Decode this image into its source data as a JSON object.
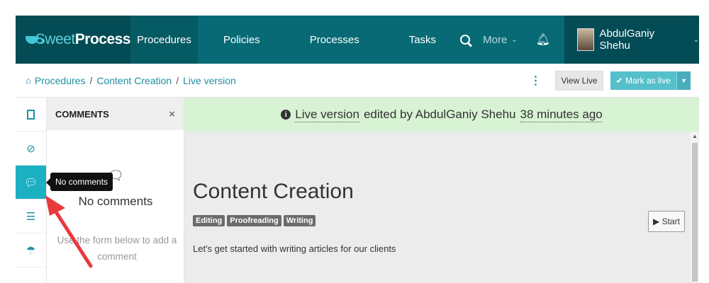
{
  "brand": {
    "name_light": "Sweet",
    "name_bold": "Process"
  },
  "nav": {
    "items": [
      {
        "label": "Procedures"
      },
      {
        "label": "Policies"
      },
      {
        "label": "Processes"
      },
      {
        "label": "Tasks"
      }
    ],
    "more_label": "More",
    "user_name": "AbdulGaniy Shehu"
  },
  "breadcrumb": {
    "items": [
      "Procedures",
      "Content Creation",
      "Live version"
    ],
    "separator": "/"
  },
  "actions": {
    "view_live": "View Live",
    "mark_as_live": "✔ Mark as live"
  },
  "comments": {
    "header": "COMMENTS",
    "close": "×",
    "empty_title": "No comments",
    "hint": "Use the form below to add a comment",
    "tooltip": "No comments"
  },
  "banner": {
    "version_link": "Live version",
    "edited_by": "edited by AbdulGaniy Shehu",
    "time_ago": "38 minutes ago"
  },
  "procedure": {
    "title": "Content Creation",
    "tags": [
      "Editing",
      "Proofreading",
      "Writing"
    ],
    "description": "Let's get started with writing articles for our clients",
    "start_label": "▶ Start"
  },
  "colors": {
    "nav_bg": "#076a75",
    "brand_bg": "#034c55",
    "accent": "#1cb0c3",
    "banner_bg": "#d8f3d4",
    "annotation_arrow": "#e8393d"
  }
}
